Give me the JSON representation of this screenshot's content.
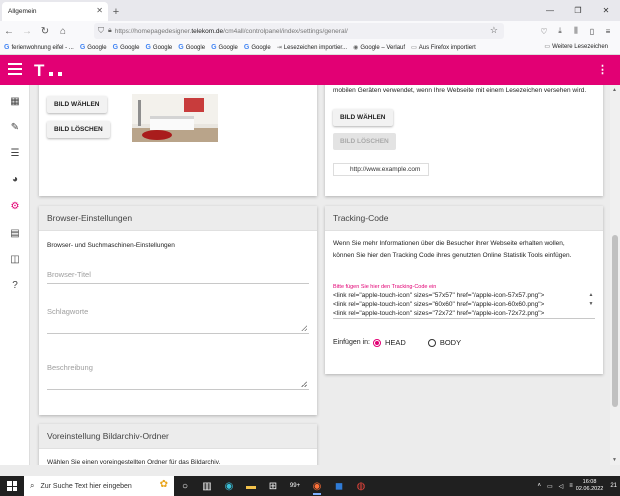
{
  "browser": {
    "tab_title": "Allgemein",
    "url_prefix": "https://homepagedesigner.",
    "url_host": "telekom.de",
    "url_path": "/cm4all/controlpanel/index/settings/general/",
    "bookmarks": [
      {
        "label": "ferienwohnung eifel - ...",
        "icon": "google-icon"
      },
      {
        "label": "Google",
        "icon": "google-icon"
      },
      {
        "label": "Google",
        "icon": "google-icon"
      },
      {
        "label": "Google",
        "icon": "google-icon"
      },
      {
        "label": "Google",
        "icon": "google-icon"
      },
      {
        "label": "Google",
        "icon": "google-icon"
      },
      {
        "label": "Google",
        "icon": "google-icon"
      },
      {
        "label": "Lesezeichen importier...",
        "icon": "import-icon"
      },
      {
        "label": "Google – Verlauf",
        "icon": "globe-icon"
      },
      {
        "label": "Aus Firefox importiert",
        "icon": "folder-icon"
      }
    ],
    "bookmarks_other": "Weitere Lesezeichen"
  },
  "app": {
    "brand_color": "#e20074",
    "brand_letter": "T"
  },
  "image_card": {
    "btn_choose": "BILD WÄHLEN",
    "btn_delete": "BILD LÖSCHEN"
  },
  "favicon_card": {
    "desc": "mobilen Geräten verwendet, wenn Ihre Webseite mit einem Lesezeichen versehen wird.",
    "btn_choose": "BILD WÄHLEN",
    "btn_delete": "BILD LÖSCHEN",
    "url_example": "http://www.example.com"
  },
  "browser_settings": {
    "title": "Browser-Einstellungen",
    "subtitle": "Browser- und Suchmaschinen-Einstellungen",
    "field_title": "Browser-Titel",
    "field_keywords": "Schlagworte",
    "field_description": "Beschreibung"
  },
  "tracking": {
    "title": "Tracking-Code",
    "desc_line1": "Wenn Sie mehr Informationen über die Besucher ihrer Webseite erhalten wollen,",
    "desc_line2": "können Sie hier den Tracking Code ihres genutzten Online Statistik Tools einfügen.",
    "code_label": "Bitte fügen Sie hier den Tracking-Code ein",
    "code_lines": [
      "<link rel=\"apple-touch-icon\" sizes=\"57x57\" href=\"/apple-icon-57x57.png\">",
      "<link rel=\"apple-touch-icon\" sizes=\"60x60\" href=\"/apple-icon-60x60.png\">",
      "<link rel=\"apple-touch-icon\" sizes=\"72x72\" href=\"/apple-icon-72x72.png\">"
    ],
    "insert_label": "Einfügen in:",
    "option_head": "HEAD",
    "option_body": "BODY",
    "selected": "HEAD"
  },
  "image_archive": {
    "title": "Voreinstellung Bildarchiv-Ordner",
    "desc": "Wählen Sie einen voreingestellten Ordner für das Bildarchiv."
  },
  "taskbar": {
    "search_placeholder": "Zur Suche Text hier eingeben",
    "time": "16:08",
    "date": "02.06.2022",
    "badge": "99+",
    "notif": "21"
  }
}
